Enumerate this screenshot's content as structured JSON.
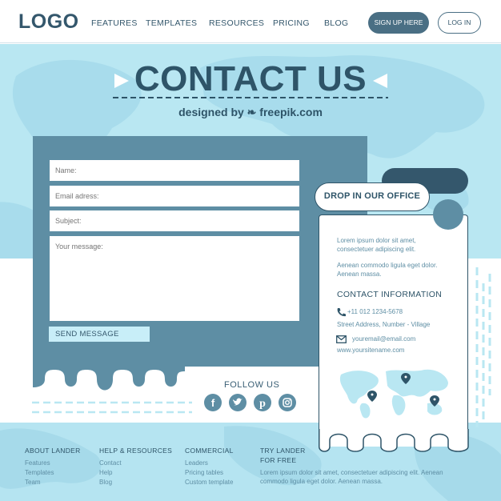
{
  "header": {
    "logo": "LOGO",
    "nav": [
      "FEATURES",
      "TEMPLATES",
      "RESOURCES",
      "PRICING",
      "BLOG"
    ],
    "signup_label": "SIGN UP HERE",
    "login_label": "LOG IN"
  },
  "hero": {
    "title": "CONTACT US",
    "credit": "designed by ❧ freepik.com"
  },
  "form": {
    "name_placeholder": "Name:",
    "email_placeholder": "Email adress:",
    "subject_placeholder": "Subject:",
    "message_placeholder": "Your message:",
    "send_label": "SEND MESSAGE"
  },
  "follow": {
    "label": "FOLLOW US",
    "icons": [
      "facebook-icon",
      "twitter-icon",
      "pinterest-icon",
      "instagram-icon"
    ]
  },
  "office": {
    "title": "DROP IN OUR OFFICE",
    "text1_line1": "Lorem ipsum dolor sit amet,",
    "text1_line2": "consectetuer adipiscing elit.",
    "text2_line1": "Aenean commodo ligula eget dolor.",
    "text2_line2": "Aenean massa.",
    "contact_heading": "CONTACT INFORMATION",
    "phone": "+11 012 1234-5678",
    "address": "Street Address, Number - Village",
    "email": "youremail@email.com",
    "website": "www.yoursitename.com"
  },
  "footer": {
    "about": {
      "heading": "ABOUT LANDER",
      "links": [
        "Features",
        "Templates",
        "Team"
      ]
    },
    "help": {
      "heading": "HELP & RESOURCES",
      "links": [
        "Contact",
        "Help",
        "Blog"
      ]
    },
    "commercial": {
      "heading": "COMMERCIAL",
      "links": [
        "Leaders",
        "Pricing tables",
        "Custom template"
      ]
    },
    "try": {
      "heading_line1": "TRY LANDER",
      "heading_line2": "FOR FREE",
      "text_line1": "Lorem ipsum dolor sit amet, consectetuer adipiscing elit. Aenean",
      "text_line2": "commodo ligula eget dolor. Aenean massa."
    }
  },
  "colors": {
    "dark_navy": "#2e5468",
    "slate_blue": "#5e8ea4",
    "light_cyan": "#b9e7f2",
    "pale_cyan": "#c8eef8"
  }
}
